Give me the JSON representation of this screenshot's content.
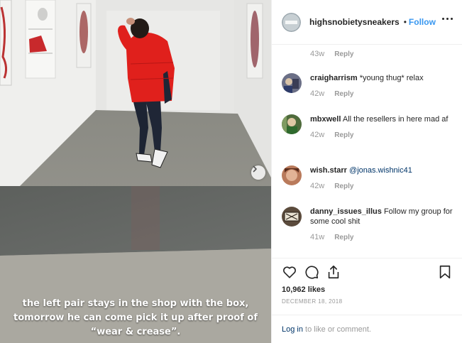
{
  "post": {
    "caption_line1": "the left pair stays in the shop with the box,",
    "caption_line2": "tomorrow he can come pick it up after proof of",
    "caption_line3": "“wear & crease”.",
    "next_icon": "chevron-right-icon"
  },
  "header": {
    "username": "highsnobietysneakers",
    "separator": "•",
    "follow_label": "Follow",
    "more_icon": "more-options-icon"
  },
  "comments": {
    "partial": {
      "time": "43w",
      "reply_label": "Reply"
    },
    "items": [
      {
        "username": "craigharrism",
        "text": "*young thug* relax",
        "time": "42w",
        "reply_label": "Reply"
      },
      {
        "username": "mbxwell",
        "text": "All the resellers in here mad af",
        "time": "42w",
        "reply_label": "Reply"
      },
      {
        "username": "wish.starr",
        "text": "@jonas.wishnic41",
        "time": "42w",
        "reply_label": "Reply"
      },
      {
        "username": "danny_issues_illus",
        "text": "Follow my group for some cool shit",
        "time": "41w",
        "reply_label": "Reply"
      }
    ]
  },
  "actions": {
    "icons": [
      "heart-icon",
      "comment-icon",
      "share-icon",
      "bookmark-icon"
    ],
    "likes": "10,962 likes",
    "date": "DECEMBER 18, 2018"
  },
  "login": {
    "link_label": "Log in",
    "rest_text": " to like or comment."
  },
  "colors": {
    "accent": "#3897f0",
    "text": "#262626",
    "muted": "#999999",
    "link": "#003569",
    "jacket": "#e0201c"
  }
}
